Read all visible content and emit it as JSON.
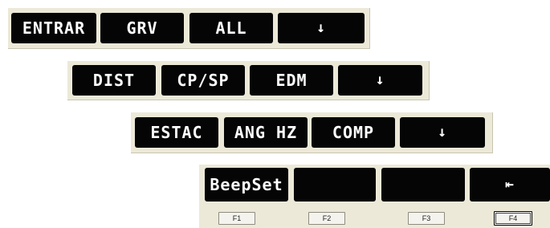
{
  "rows": [
    {
      "keys": [
        "ENTRAR",
        "GRV",
        "ALL",
        "↓"
      ]
    },
    {
      "keys": [
        "DIST",
        "CP/SP",
        "EDM",
        "↓"
      ]
    },
    {
      "keys": [
        "ESTAC",
        "ANG HZ",
        "COMP",
        "↓"
      ]
    },
    {
      "keys": [
        "BeepSet",
        "",
        "",
        "⇤"
      ]
    }
  ],
  "function_keys": [
    "F1",
    "F2",
    "F3",
    "F4"
  ],
  "icons": {
    "down": "arrow-down-icon",
    "back": "arrow-left-to-bar-icon"
  }
}
